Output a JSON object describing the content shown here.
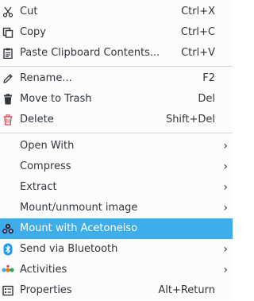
{
  "menu": {
    "items": [
      {
        "label": "Cut",
        "shortcut": "Ctrl+X",
        "icon": "scissors-icon"
      },
      {
        "label": "Copy",
        "shortcut": "Ctrl+C",
        "icon": "copy-icon"
      },
      {
        "label": "Paste Clipboard Contents...",
        "shortcut": "Ctrl+V",
        "icon": "clipboard-paste-icon"
      },
      {
        "label": "Rename...",
        "shortcut": "F2",
        "icon": "pencil-icon"
      },
      {
        "label": "Move to Trash",
        "shortcut": "Del",
        "icon": "trash-icon"
      },
      {
        "label": "Delete",
        "shortcut": "Shift+Del",
        "icon": "delete-bin-icon"
      },
      {
        "label": "Open With",
        "shortcut": "",
        "submenu": true
      },
      {
        "label": "Compress",
        "shortcut": "",
        "submenu": true
      },
      {
        "label": "Extract",
        "shortcut": "",
        "submenu": true
      },
      {
        "label": "Mount/unmount image",
        "shortcut": "",
        "submenu": true
      },
      {
        "label": "Mount with Acetoneiso",
        "shortcut": "",
        "icon": "acetoneiso-icon",
        "highlighted": true
      },
      {
        "label": "Send via Bluetooth",
        "shortcut": "",
        "icon": "bluetooth-icon",
        "submenu": true
      },
      {
        "label": "Activities",
        "shortcut": "",
        "icon": "activities-icon",
        "submenu": true
      },
      {
        "label": "Properties",
        "shortcut": "Alt+Return",
        "icon": "properties-icon"
      }
    ],
    "submenu_glyph": "›"
  },
  "colors": {
    "highlight": "#3daee9",
    "text": "#31363b",
    "background": "#fcfcfc",
    "delete_icon": "#da4453",
    "bluetooth_icon": "#1d99f3"
  }
}
